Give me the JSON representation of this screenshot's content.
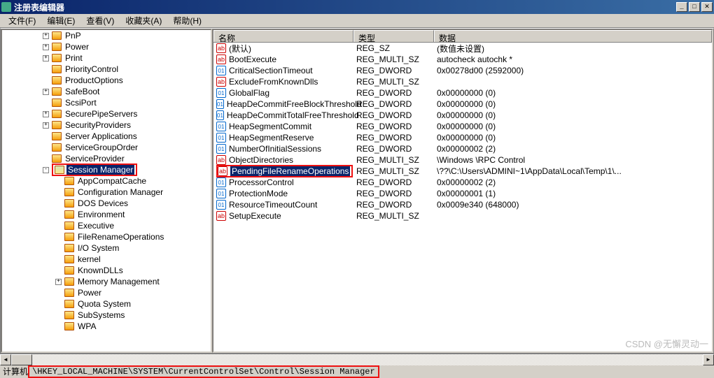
{
  "window": {
    "title": "注册表编辑器"
  },
  "menu": {
    "file": "文件(F)",
    "edit": "编辑(E)",
    "view": "查看(V)",
    "favorites": "收藏夹(A)",
    "help": "帮助(H)"
  },
  "tree": {
    "items": [
      {
        "indent": 3,
        "exp": "+",
        "label": "PnP"
      },
      {
        "indent": 3,
        "exp": "+",
        "label": "Power"
      },
      {
        "indent": 3,
        "exp": "+",
        "label": "Print"
      },
      {
        "indent": 3,
        "exp": "",
        "label": "PriorityControl"
      },
      {
        "indent": 3,
        "exp": "",
        "label": "ProductOptions"
      },
      {
        "indent": 3,
        "exp": "+",
        "label": "SafeBoot"
      },
      {
        "indent": 3,
        "exp": "",
        "label": "ScsiPort"
      },
      {
        "indent": 3,
        "exp": "+",
        "label": "SecurePipeServers"
      },
      {
        "indent": 3,
        "exp": "+",
        "label": "SecurityProviders"
      },
      {
        "indent": 3,
        "exp": "",
        "label": "Server Applications"
      },
      {
        "indent": 3,
        "exp": "",
        "label": "ServiceGroupOrder"
      },
      {
        "indent": 3,
        "exp": "",
        "label": "ServiceProvider"
      },
      {
        "indent": 3,
        "exp": "-",
        "label": "Session Manager",
        "selected": true,
        "highlight": true,
        "open": true
      },
      {
        "indent": 4,
        "exp": "",
        "label": "AppCompatCache"
      },
      {
        "indent": 4,
        "exp": "",
        "label": "Configuration Manager"
      },
      {
        "indent": 4,
        "exp": "",
        "label": "DOS Devices"
      },
      {
        "indent": 4,
        "exp": "",
        "label": "Environment"
      },
      {
        "indent": 4,
        "exp": "",
        "label": "Executive"
      },
      {
        "indent": 4,
        "exp": "",
        "label": "FileRenameOperations"
      },
      {
        "indent": 4,
        "exp": "",
        "label": "I/O System"
      },
      {
        "indent": 4,
        "exp": "",
        "label": "kernel"
      },
      {
        "indent": 4,
        "exp": "",
        "label": "KnownDLLs"
      },
      {
        "indent": 4,
        "exp": "+",
        "label": "Memory Management"
      },
      {
        "indent": 4,
        "exp": "",
        "label": "Power"
      },
      {
        "indent": 4,
        "exp": "",
        "label": "Quota System"
      },
      {
        "indent": 4,
        "exp": "",
        "label": "SubSystems"
      },
      {
        "indent": 4,
        "exp": "",
        "label": "WPA"
      }
    ]
  },
  "list": {
    "headers": {
      "name": "名称",
      "type": "类型",
      "data": "数据"
    },
    "rows": [
      {
        "icon": "sz",
        "name": "(默认)",
        "type": "REG_SZ",
        "data": "(数值未设置)"
      },
      {
        "icon": "sz",
        "name": "BootExecute",
        "type": "REG_MULTI_SZ",
        "data": "autocheck autochk *"
      },
      {
        "icon": "dw",
        "name": "CriticalSectionTimeout",
        "type": "REG_DWORD",
        "data": "0x00278d00 (2592000)"
      },
      {
        "icon": "sz",
        "name": "ExcludeFromKnownDlls",
        "type": "REG_MULTI_SZ",
        "data": ""
      },
      {
        "icon": "dw",
        "name": "GlobalFlag",
        "type": "REG_DWORD",
        "data": "0x00000000 (0)"
      },
      {
        "icon": "dw",
        "name": "HeapDeCommitFreeBlockThreshold",
        "type": "REG_DWORD",
        "data": "0x00000000 (0)"
      },
      {
        "icon": "dw",
        "name": "HeapDeCommitTotalFreeThreshold",
        "type": "REG_DWORD",
        "data": "0x00000000 (0)"
      },
      {
        "icon": "dw",
        "name": "HeapSegmentCommit",
        "type": "REG_DWORD",
        "data": "0x00000000 (0)"
      },
      {
        "icon": "dw",
        "name": "HeapSegmentReserve",
        "type": "REG_DWORD",
        "data": "0x00000000 (0)"
      },
      {
        "icon": "dw",
        "name": "NumberOfInitialSessions",
        "type": "REG_DWORD",
        "data": "0x00000002 (2)"
      },
      {
        "icon": "sz",
        "name": "ObjectDirectories",
        "type": "REG_MULTI_SZ",
        "data": "\\Windows \\RPC Control"
      },
      {
        "icon": "sz",
        "name": "PendingFileRenameOperations",
        "type": "REG_MULTI_SZ",
        "data": "\\??\\C:\\Users\\ADMINI~1\\AppData\\Local\\Temp\\1\\...",
        "selected": true,
        "highlight": true
      },
      {
        "icon": "dw",
        "name": "ProcessorControl",
        "type": "REG_DWORD",
        "data": "0x00000002 (2)"
      },
      {
        "icon": "dw",
        "name": "ProtectionMode",
        "type": "REG_DWORD",
        "data": "0x00000001 (1)"
      },
      {
        "icon": "dw",
        "name": "ResourceTimeoutCount",
        "type": "REG_DWORD",
        "data": "0x0009e340 (648000)"
      },
      {
        "icon": "sz",
        "name": "SetupExecute",
        "type": "REG_MULTI_SZ",
        "data": ""
      }
    ]
  },
  "status": {
    "prefix": "计算机",
    "path": "\\HKEY_LOCAL_MACHINE\\SYSTEM\\CurrentControlSet\\Control\\Session Manager"
  },
  "watermark": "CSDN @无懈灵动一"
}
